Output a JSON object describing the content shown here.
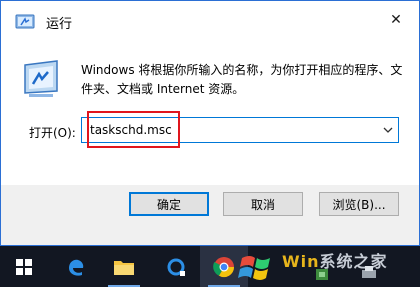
{
  "window": {
    "title": "运行",
    "close_glyph": "✕"
  },
  "content": {
    "description": "Windows 将根据你所输入的名称，为你打开相应的程序、文件夹、文档或 Internet 资源。",
    "open_label": "打开(O):",
    "input_value": "taskschd.msc"
  },
  "buttons": {
    "ok": "确定",
    "cancel": "取消",
    "browse": "浏览(B)..."
  },
  "taskbar": {
    "icons": [
      "windows-start-icon",
      "edge-icon",
      "file-explorer-icon",
      "cortana-icon",
      "chrome-icon",
      "windows-flag-icon",
      "game-icon",
      "printer-icon"
    ],
    "watermark": "系统之家",
    "watermark_prefix": "Win"
  },
  "colors": {
    "accent": "#0078d7",
    "highlight": "#e0161d",
    "taskbar": "#121722"
  }
}
